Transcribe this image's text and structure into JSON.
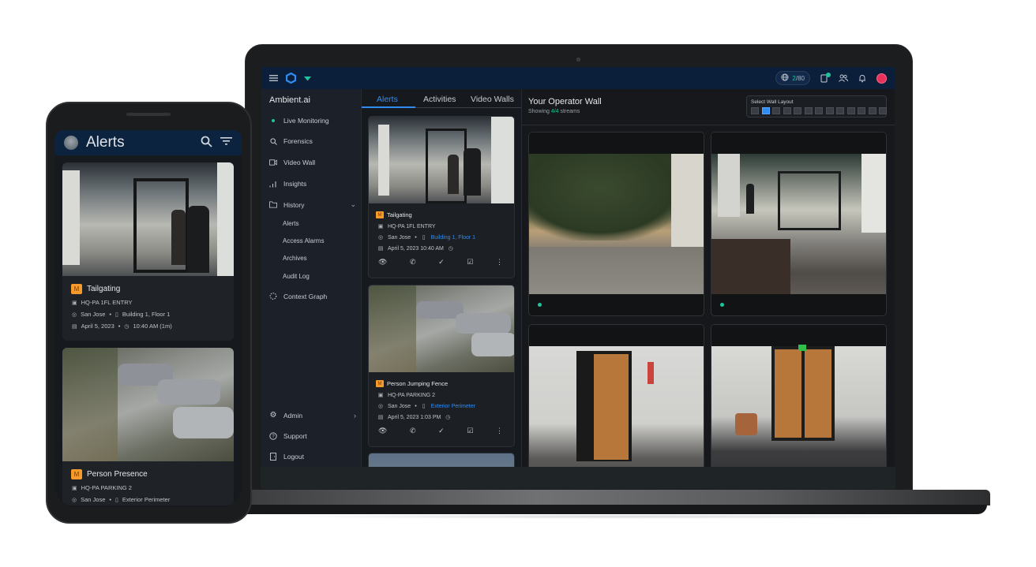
{
  "desktop": {
    "topbar": {
      "menu_icon": "hamburger-icon",
      "logo_icon": "hexagon-logo-icon",
      "status_icon": "signal-icon",
      "globe_counter": {
        "value": "2",
        "total": "/80"
      },
      "icons": [
        "tablet-notification-icon",
        "users-icon",
        "bell-icon",
        "user-avatar"
      ],
      "accent": "#2f8cf0",
      "status_color": "#1fc49a"
    },
    "sidebar": {
      "brand": "Ambient.ai",
      "items": [
        {
          "label": "Live Monitoring",
          "icon": "status-dot"
        },
        {
          "label": "Forensics",
          "icon": "search-icon"
        },
        {
          "label": "Video Wall",
          "icon": "video-camera-icon"
        },
        {
          "label": "Insights",
          "icon": "bar-chart-icon"
        },
        {
          "label": "History",
          "icon": "folder-icon",
          "expanded": true
        }
      ],
      "history_subitems": [
        "Alerts",
        "Access Alarms",
        "Archives",
        "Audit Log"
      ],
      "context_graph": "Context Graph",
      "bottom_items": [
        {
          "label": "Admin",
          "icon": "gear-icon"
        },
        {
          "label": "Support",
          "icon": "help-icon"
        },
        {
          "label": "Logout",
          "icon": "logout-icon"
        }
      ]
    },
    "tabs": [
      {
        "label": "Alerts",
        "active": true
      },
      {
        "label": "Activities",
        "active": false
      },
      {
        "label": "Video Walls",
        "active": false
      }
    ],
    "alerts": [
      {
        "badge": "M",
        "title": "Tailgating",
        "camera": "HQ-PA 1FL ENTRY",
        "site": "San Jose",
        "location": "Building 1, Floor 1",
        "datetime": "April 5, 2023 10:40 AM"
      },
      {
        "badge": "M",
        "title": "Person Jumping Fence",
        "camera": "HQ-PA PARKING 2",
        "site": "San Jose",
        "location": "Exterior Perimeter",
        "datetime": "April 5, 2023 1:03 PM"
      }
    ],
    "wall": {
      "title": "Your Operator Wall",
      "showing_prefix": "Showing ",
      "showing_count": "4/4",
      "showing_suffix": " streams",
      "layout_label": "Select Wall Layout",
      "layout_options": 13,
      "layout_selected_index": 1,
      "streams": 4
    }
  },
  "phone": {
    "title": "Alerts",
    "icons": [
      "search-icon",
      "filter-icon"
    ],
    "alerts": [
      {
        "badge": "M",
        "title": "Tailgating",
        "camera": "HQ-PA 1FL ENTRY",
        "site": "San Jose",
        "location": "Building 1, Floor 1",
        "date": "April 5, 2023",
        "time": "10:40 AM (1m)"
      },
      {
        "badge": "M",
        "title": "Person Presence",
        "camera": "HQ-PA PARKING 2",
        "site": "San Jose",
        "location": "Exterior Perimeter"
      }
    ]
  }
}
